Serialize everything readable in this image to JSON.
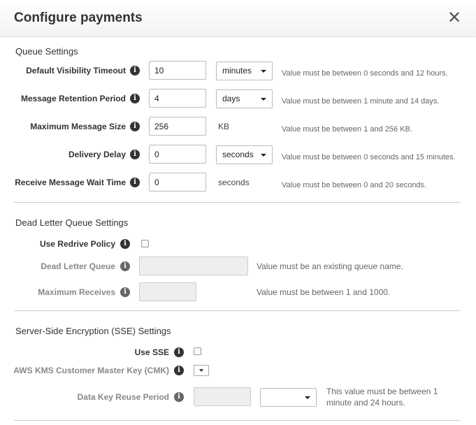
{
  "dialog": {
    "title": "Configure payments",
    "close_label": "✕"
  },
  "queue": {
    "section_title": "Queue Settings",
    "visibility": {
      "label": "Default Visibility Timeout",
      "value": "10",
      "unit": "minutes",
      "hint": "Value must be between 0 seconds and 12 hours."
    },
    "retention": {
      "label": "Message Retention Period",
      "value": "4",
      "unit": "days",
      "hint": "Value must be between 1 minute and 14 days."
    },
    "max_size": {
      "label": "Maximum Message Size",
      "value": "256",
      "unit": "KB",
      "hint": "Value must be between 1 and 256 KB."
    },
    "delay": {
      "label": "Delivery Delay",
      "value": "0",
      "unit": "seconds",
      "hint": "Value must be between 0 seconds and 15 minutes."
    },
    "wait_time": {
      "label": "Receive Message Wait Time",
      "value": "0",
      "unit": "seconds",
      "hint": "Value must be between 0 and 20 seconds."
    }
  },
  "dlq": {
    "section_title": "Dead Letter Queue Settings",
    "redrive": {
      "label": "Use Redrive Policy",
      "checked": false
    },
    "queue_name": {
      "label": "Dead Letter Queue",
      "value": "",
      "hint": "Value must be an existing queue name."
    },
    "max_receives": {
      "label": "Maximum Receives",
      "value": "",
      "hint": "Value must be between 1 and 1000."
    }
  },
  "sse": {
    "section_title": "Server-Side Encryption (SSE) Settings",
    "use_sse": {
      "label": "Use SSE",
      "checked": false
    },
    "cmk": {
      "label": "AWS KMS Customer Master Key (CMK)"
    },
    "reuse": {
      "label": "Data Key Reuse Period",
      "value": "",
      "unit": "",
      "hint_line1": "This value must be between 1",
      "hint_line2": "minute and 24 hours."
    }
  },
  "icons": {
    "info": "info-icon",
    "close": "close-icon",
    "dropdown": "chevron-down-icon"
  }
}
